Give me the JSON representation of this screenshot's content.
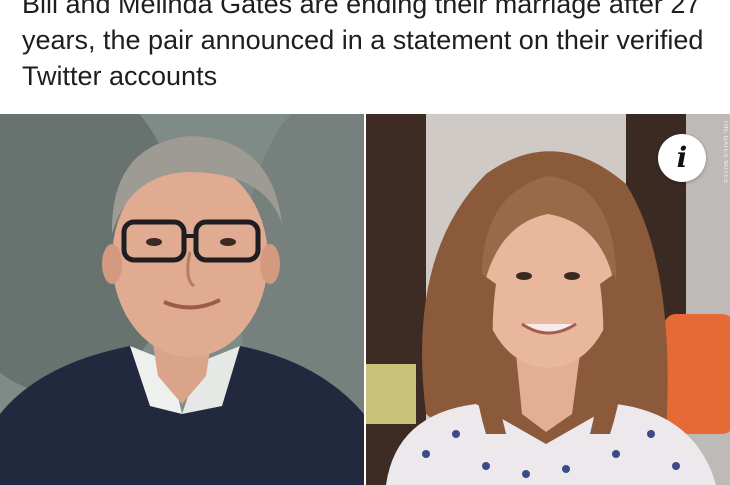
{
  "post": {
    "caption": "Bill and Melinda Gates are ending their marriage after 27 years, the pair announced in a statement on their verified Twitter accounts"
  },
  "photos": {
    "left_alt": "Bill Gates",
    "right_alt": "Melinda Gates",
    "info_icon": "info-icon",
    "info_glyph": "i",
    "watermark": "THE GATES NOTES"
  }
}
